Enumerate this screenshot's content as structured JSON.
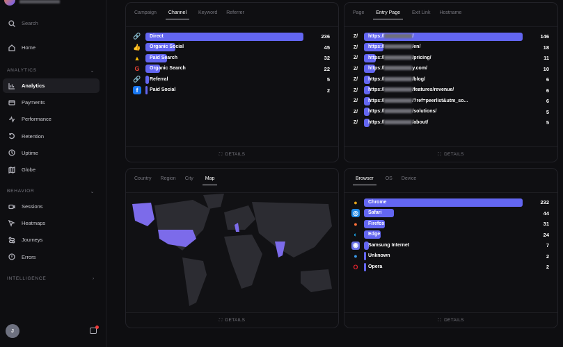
{
  "sidebar": {
    "search": "Search",
    "home": "Home",
    "sections": {
      "analytics": "ANALYTICS",
      "behavior": "BEHAVIOR",
      "intelligence": "INTELLIGENCE"
    },
    "analytics_items": [
      {
        "label": "Analytics",
        "icon": "bar-chart-icon"
      },
      {
        "label": "Payments",
        "icon": "credit-card-icon"
      },
      {
        "label": "Performance",
        "icon": "pulse-icon"
      },
      {
        "label": "Retention",
        "icon": "rotate-icon"
      },
      {
        "label": "Uptime",
        "icon": "clock-icon"
      },
      {
        "label": "Globe",
        "icon": "map-icon"
      }
    ],
    "behavior_items": [
      {
        "label": "Sessions",
        "icon": "video-icon"
      },
      {
        "label": "Heatmaps",
        "icon": "cursor-icon"
      },
      {
        "label": "Journeys",
        "icon": "route-icon"
      },
      {
        "label": "Errors",
        "icon": "alert-circle-icon"
      }
    ],
    "avatar": "J"
  },
  "details_label": "DETAILS",
  "channel": {
    "tabs": [
      "Campaign",
      "Channel",
      "Keyword",
      "Referrer"
    ],
    "active": 1,
    "rows": [
      {
        "label": "Direct",
        "value": 236,
        "icon": "link-icon"
      },
      {
        "label": "Organic Social",
        "value": 45,
        "icon": "thumbs-up-icon"
      },
      {
        "label": "Paid Search",
        "value": 32,
        "icon": "google-ads-icon"
      },
      {
        "label": "Organic Search",
        "value": 22,
        "icon": "google-icon"
      },
      {
        "label": "Referral",
        "value": 5,
        "icon": "link-icon"
      },
      {
        "label": "Paid Social",
        "value": 2,
        "icon": "facebook-icon"
      }
    ]
  },
  "pages": {
    "tabs": [
      "Page",
      "Entry Page",
      "Exit Link",
      "Hostname"
    ],
    "active": 1,
    "rows": [
      {
        "prefix": "https://",
        "label": "/",
        "value": 146
      },
      {
        "prefix": "https://",
        "label": "/en/",
        "value": 18
      },
      {
        "prefix": "https://",
        "label": "/pricing/",
        "value": 11
      },
      {
        "prefix": "https://",
        "label": "y.com/",
        "value": 10
      },
      {
        "prefix": "https://",
        "label": "/blog/",
        "value": 6
      },
      {
        "prefix": "https://",
        "label": "/features/revenue/",
        "value": 6
      },
      {
        "prefix": "https://",
        "label": "/?ref=peerlist&utm_so...",
        "value": 6
      },
      {
        "prefix": "https://",
        "label": "/solutions/",
        "value": 5
      },
      {
        "prefix": "https://",
        "label": "/about/",
        "value": 5
      }
    ]
  },
  "geo": {
    "tabs": [
      "Country",
      "Region",
      "City",
      "Map"
    ],
    "active": 3
  },
  "browser": {
    "tabs": [
      "Browser",
      "OS",
      "Device"
    ],
    "active": 0,
    "rows": [
      {
        "label": "Chrome",
        "value": 232,
        "icon": "chrome-icon"
      },
      {
        "label": "Safari",
        "value": 44,
        "icon": "safari-icon"
      },
      {
        "label": "Firefox",
        "value": 31,
        "icon": "firefox-icon"
      },
      {
        "label": "Edge",
        "value": 24,
        "icon": "edge-icon"
      },
      {
        "label": "Samsung Internet",
        "value": 7,
        "icon": "samsung-internet-icon"
      },
      {
        "label": "Unknown",
        "value": 2,
        "icon": "unknown-browser-icon"
      },
      {
        "label": "Opera",
        "value": 2,
        "icon": "opera-icon"
      }
    ]
  },
  "colors": {
    "accent": "#6366f1"
  }
}
